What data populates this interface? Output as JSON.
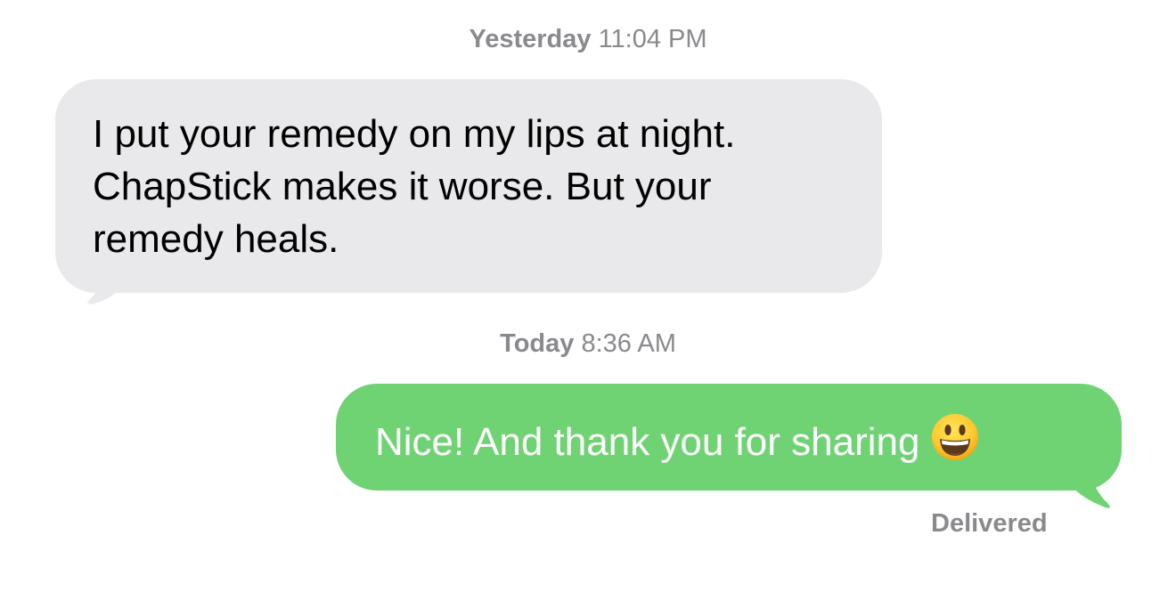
{
  "thread": {
    "messages": [
      {
        "timestamp_day": "Yesterday",
        "timestamp_time": "11:04 PM",
        "direction": "incoming",
        "lines": [
          "I put your remedy on my lips at night.",
          "ChapStick makes it worse. But your",
          "remedy heals."
        ]
      },
      {
        "timestamp_day": "Today",
        "timestamp_time": "8:36 AM",
        "direction": "outgoing",
        "text": "Nice! And thank you for sharing",
        "emoji": "grinning-face-icon",
        "status": "Delivered"
      }
    ]
  },
  "colors": {
    "incoming_bubble": "#e9e9eb",
    "outgoing_bubble": "#6fd373",
    "meta_text": "#8a8a8e"
  }
}
